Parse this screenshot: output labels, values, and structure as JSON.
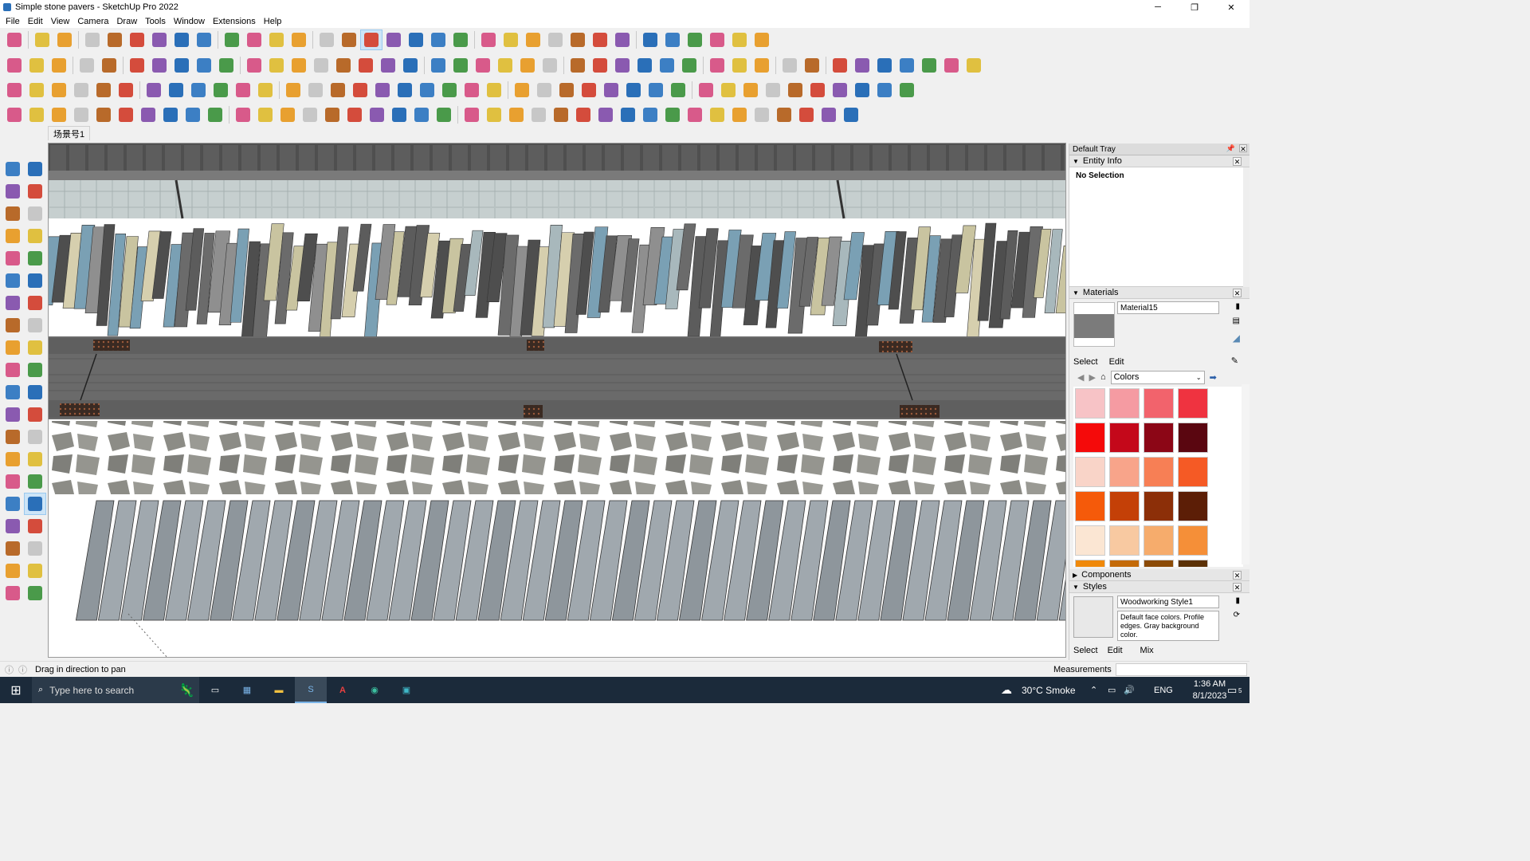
{
  "window": {
    "title": "Simple stone pavers - SketchUp Pro 2022",
    "minimize": "─",
    "maximize": "❐",
    "close": "✕"
  },
  "menu": [
    "File",
    "Edit",
    "View",
    "Camera",
    "Draw",
    "Tools",
    "Window",
    "Extensions",
    "Help"
  ],
  "scene_tab": "场景号1",
  "tray": {
    "title": "Default Tray",
    "entity_info": {
      "header": "Entity Info",
      "text": "No Selection"
    },
    "materials": {
      "header": "Materials",
      "name": "Material15",
      "tab_select": "Select",
      "tab_edit": "Edit",
      "library": "Colors",
      "swatch_colors": [
        "#f7c3c6",
        "#f59ba2",
        "#f2636c",
        "#ef3340",
        "#f50a0a",
        "#c4081a",
        "#8c0616",
        "#5a0610",
        "#f9d4c8",
        "#f8a48a",
        "#f77f55",
        "#f55a25",
        "#f55a0a",
        "#c44007",
        "#8c2f08",
        "#5c1e06",
        "#fbe6d3",
        "#f8c9a1",
        "#f6ac6c",
        "#f58f38",
        "#f0890a",
        "#c46a08",
        "#8c4b07",
        "#5c3106"
      ]
    },
    "components": {
      "header": "Components"
    },
    "styles": {
      "header": "Styles",
      "name": "Woodworking Style1",
      "description": "Default face colors. Profile edges. Gray background color.",
      "tab_select": "Select",
      "tab_edit": "Edit",
      "tab_mix": "Mix"
    }
  },
  "status": {
    "text": "Drag in direction to pan",
    "measurements_label": "Measurements"
  },
  "taskbar": {
    "search_placeholder": "Type here to search",
    "weather": "30°C  Smoke",
    "language": "ENG",
    "time": "1:36 AM",
    "date": "8/1/2023",
    "notifications": "5"
  },
  "toolbar_icons": {
    "row1": [
      "zoom",
      "select",
      "eraser",
      "line",
      "arc",
      "shape",
      "push-pull",
      "follow-me",
      "move",
      "rotate",
      "scale",
      "tape",
      "text",
      "paint",
      "orbit",
      "pan",
      "zoom",
      "zoom-extents",
      "section",
      "section-cut",
      "layers",
      "match-photo",
      "position-camera",
      "look-around",
      "walk",
      "3d-warehouse",
      "extension-warehouse",
      "sandbox",
      "sandbox-flip",
      "sandbox-stamp",
      "undo",
      "redo",
      "share"
    ],
    "row2_count": 42,
    "row3_count": 40,
    "row4_count": 38,
    "left_count": 40
  }
}
